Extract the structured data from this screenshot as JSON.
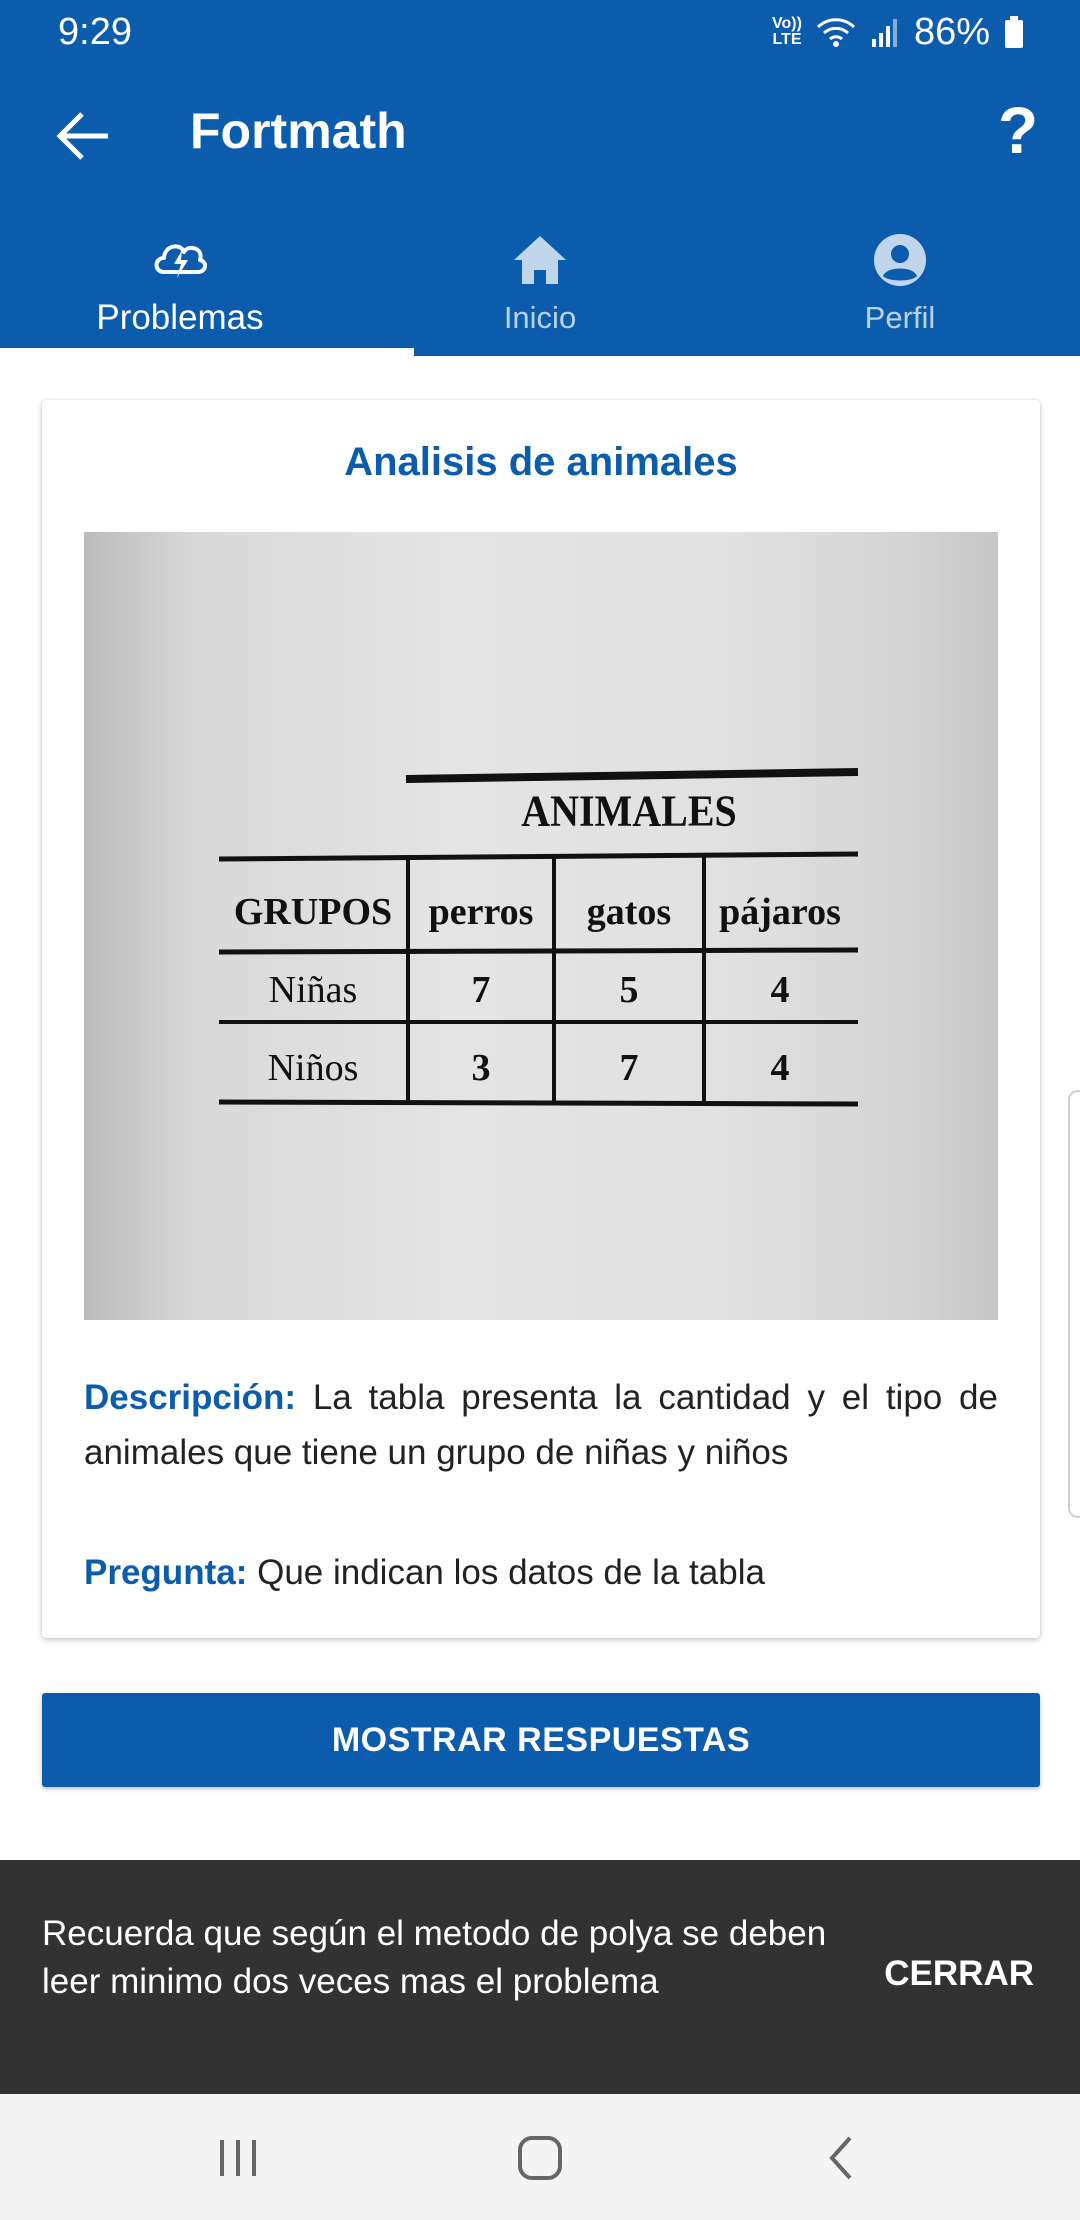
{
  "status_bar": {
    "time": "9:29",
    "network": "Vo)) LTE",
    "battery": "86%"
  },
  "app_bar": {
    "title": "Fortmath",
    "help_label": "?"
  },
  "tabs": [
    {
      "label": "Problemas",
      "icon": "lightning-cloud-icon",
      "active": true
    },
    {
      "label": "Inicio",
      "icon": "home-icon",
      "active": false
    },
    {
      "label": "Perfil",
      "icon": "account-circle-icon",
      "active": false
    }
  ],
  "problem": {
    "title": "Analisis de animales",
    "image": {
      "header": "ANIMALES",
      "columns": [
        "GRUPOS",
        "perros",
        "gatos",
        "pájaros"
      ],
      "rows": [
        [
          "Niñas",
          "7",
          "5",
          "4"
        ],
        [
          "Niños",
          "3",
          "7",
          "4"
        ]
      ]
    },
    "description_label": "Descripción:",
    "description": "La tabla presenta la cantidad y el tipo de animales que tiene un grupo de niñas y niños",
    "question_label": "Pregunta:",
    "question": "Que indican los datos de la tabla"
  },
  "show_answers_button": "MOSTRAR RESPUESTAS",
  "snackbar": {
    "message": "Recuerda que según el metodo de polya se deben leer minimo dos veces mas el problema",
    "action": "CERRAR"
  },
  "colors": {
    "primary": "#0b5cad",
    "snackbar": "#323232"
  }
}
